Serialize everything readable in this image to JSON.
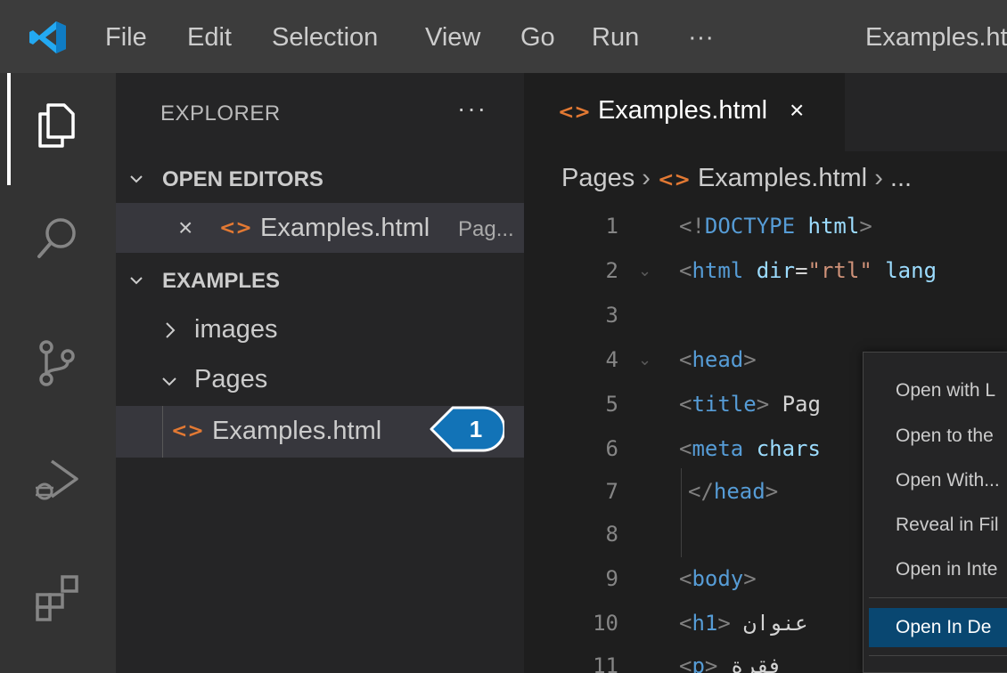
{
  "titlebar": {
    "menu": [
      "File",
      "Edit",
      "Selection",
      "View",
      "Go",
      "Run",
      "···"
    ],
    "window_title": "Examples.ht"
  },
  "activity_bar": {
    "icons": [
      "explorer-icon",
      "search-icon",
      "source-control-icon",
      "run-debug-icon",
      "extensions-icon"
    ]
  },
  "sidebar": {
    "title": "EXPLORER",
    "more": "···",
    "open_editors": {
      "header": "OPEN EDITORS",
      "item": {
        "name": "Examples.html",
        "path": "Pag..."
      }
    },
    "workspace": {
      "header": "EXAMPLES",
      "folders": [
        "images",
        "Pages"
      ],
      "file": "Examples.html"
    }
  },
  "callout": {
    "number": "1"
  },
  "editor": {
    "tab": {
      "name": "Examples.html",
      "close": "×"
    },
    "breadcrumb": {
      "folder": "Pages",
      "file": "Examples.html",
      "more": "..."
    },
    "line_numbers": [
      "1",
      "2",
      "3",
      "4",
      "5",
      "6",
      "7",
      "8",
      "9",
      "10",
      "11"
    ],
    "code": {
      "l1_open": "<!",
      "l1_doctype": "DOCTYPE",
      "l1_html": "html",
      "l1_close": ">",
      "l2_open": "<",
      "l2_tag": "html",
      "l2_attr1": "dir",
      "l2_eq": "=",
      "l2_val1": "\"rtl\"",
      "l2_attr2": "lang",
      "l4_open": "<",
      "l4_tag": "head",
      "l4_close": ">",
      "l5_open": "<",
      "l5_tag": "title",
      "l5_close": ">",
      "l5_text": " Pag",
      "l6_open": "<",
      "l6_tag": "meta",
      "l6_attr": "chars",
      "l7_open": "</",
      "l7_tag": "head",
      "l7_close": ">",
      "l9_open": "<",
      "l9_tag": "body",
      "l9_close": ">",
      "l10_open": "<",
      "l10_tag": "h1",
      "l10_close": ">",
      "l10_text": " عنوان",
      "l11_open": "<",
      "l11_tag": "p",
      "l11_close": ">",
      "l11_text": " فقرة"
    }
  },
  "context_menu": {
    "items": [
      "Open with L",
      "Open to the",
      "Open With...",
      "Reveal in Fil",
      "Open in Inte",
      "Open In De"
    ]
  },
  "colors": {
    "title_bar": "#3c3c3c",
    "activity_bar": "#333333",
    "sidebar": "#252526",
    "editor": "#1e1e1e",
    "html_icon": "#e37933",
    "menu_highlight": "#094771",
    "callout": "#1273b7"
  }
}
